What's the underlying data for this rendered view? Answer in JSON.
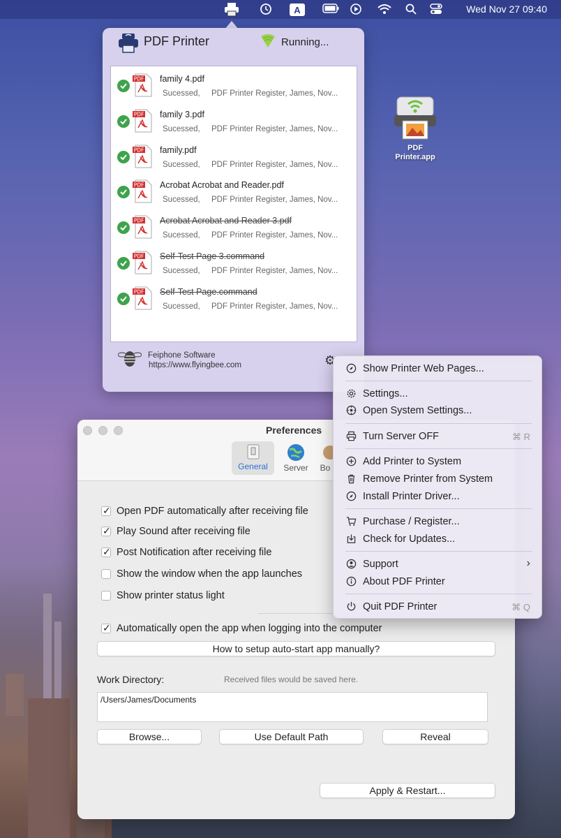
{
  "menubar": {
    "clock": "Wed Nov 27  09:40",
    "input_letter": "A",
    "icons": [
      "printer-icon",
      "time-machine-icon",
      "input-source-icon",
      "battery-icon",
      "play-icon",
      "wifi-icon",
      "search-icon",
      "control-center-icon"
    ]
  },
  "popover": {
    "title": "PDF Printer",
    "status": "Running...",
    "jobs": [
      {
        "name": "family 4.pdf",
        "status": "Sucessed,",
        "detail": "PDF Printer Register, James, Nov...",
        "struck": false
      },
      {
        "name": "family 3.pdf",
        "status": "Sucessed,",
        "detail": "PDF Printer Register, James, Nov...",
        "struck": false
      },
      {
        "name": "family.pdf",
        "status": "Sucessed,",
        "detail": "PDF Printer Register, James, Nov...",
        "struck": false
      },
      {
        "name": "Acrobat Acrobat and Reader.pdf",
        "status": "Sucessed,",
        "detail": "PDF Printer Register, James, Nov...",
        "struck": false
      },
      {
        "name": "Acrobat Acrobat and Reader 3.pdf",
        "status": "Sucessed,",
        "detail": "PDF Printer Register, James, Nov...",
        "struck": true
      },
      {
        "name": "Self-Test Page 3.command",
        "status": "Sucessed,",
        "detail": "PDF Printer Register, James, Nov...",
        "struck": true
      },
      {
        "name": "Self-Test Page.command",
        "status": "Sucessed,",
        "detail": "PDF Printer Register, James, Nov...",
        "struck": true
      }
    ],
    "pdf_badge": "PDF",
    "company": "Feiphone Software",
    "url": "https://www.flyingbee.com"
  },
  "desktop": {
    "app_label_line1": "PDF",
    "app_label_line2": "Printer.app"
  },
  "prefs": {
    "title": "Preferences",
    "tabs": [
      {
        "label": "General",
        "selected": true
      },
      {
        "label": "Server",
        "selected": false
      },
      {
        "label": "Bo",
        "selected": false
      }
    ],
    "checkboxes": [
      {
        "label": "Open PDF automatically after receiving file",
        "checked": true
      },
      {
        "label": "Play Sound after receiving file",
        "checked": true
      },
      {
        "label": "Post Notification after receiving file",
        "checked": true
      },
      {
        "label": "Show the window when the app launches",
        "checked": false
      },
      {
        "label": "Show printer status light",
        "checked": false
      },
      {
        "label": "Automatically open the app when logging into the computer",
        "checked": true
      }
    ],
    "autostart_button": "How to setup auto-start app manually?",
    "work_dir_label": "Work Directory:",
    "work_dir_hint": "Received files would be saved here.",
    "work_dir_value": "/Users/James/Documents",
    "browse_button": "Browse...",
    "default_path_button": "Use Default Path",
    "reveal_button": "Reveal",
    "apply_button": "Apply & Restart..."
  },
  "menu": {
    "items": [
      {
        "label": "Show Printer Web Pages...",
        "icon": "compass-icon",
        "shortcut": ""
      },
      {
        "label": "Settings...",
        "icon": "gear-icon",
        "shortcut": ""
      },
      {
        "label": "Open System Settings...",
        "icon": "system-gear-icon",
        "shortcut": ""
      },
      {
        "label": "Turn Server OFF",
        "icon": "printer-icon",
        "shortcut": "⌘ R"
      },
      {
        "label": "Add Printer to System",
        "icon": "plus-circle-icon",
        "shortcut": ""
      },
      {
        "label": "Remove Printer from System",
        "icon": "trash-icon",
        "shortcut": ""
      },
      {
        "label": "Install Printer Driver...",
        "icon": "compass-icon",
        "shortcut": ""
      },
      {
        "label": "Purchase / Register...",
        "icon": "cart-icon",
        "shortcut": ""
      },
      {
        "label": "Check for Updates...",
        "icon": "download-icon",
        "shortcut": ""
      },
      {
        "label": "Support",
        "icon": "person-circle-icon",
        "shortcut": ""
      },
      {
        "label": "About PDF Printer",
        "icon": "info-icon",
        "shortcut": ""
      },
      {
        "label": "Quit PDF Printer",
        "icon": "power-icon",
        "shortcut": "⌘ Q"
      }
    ]
  }
}
